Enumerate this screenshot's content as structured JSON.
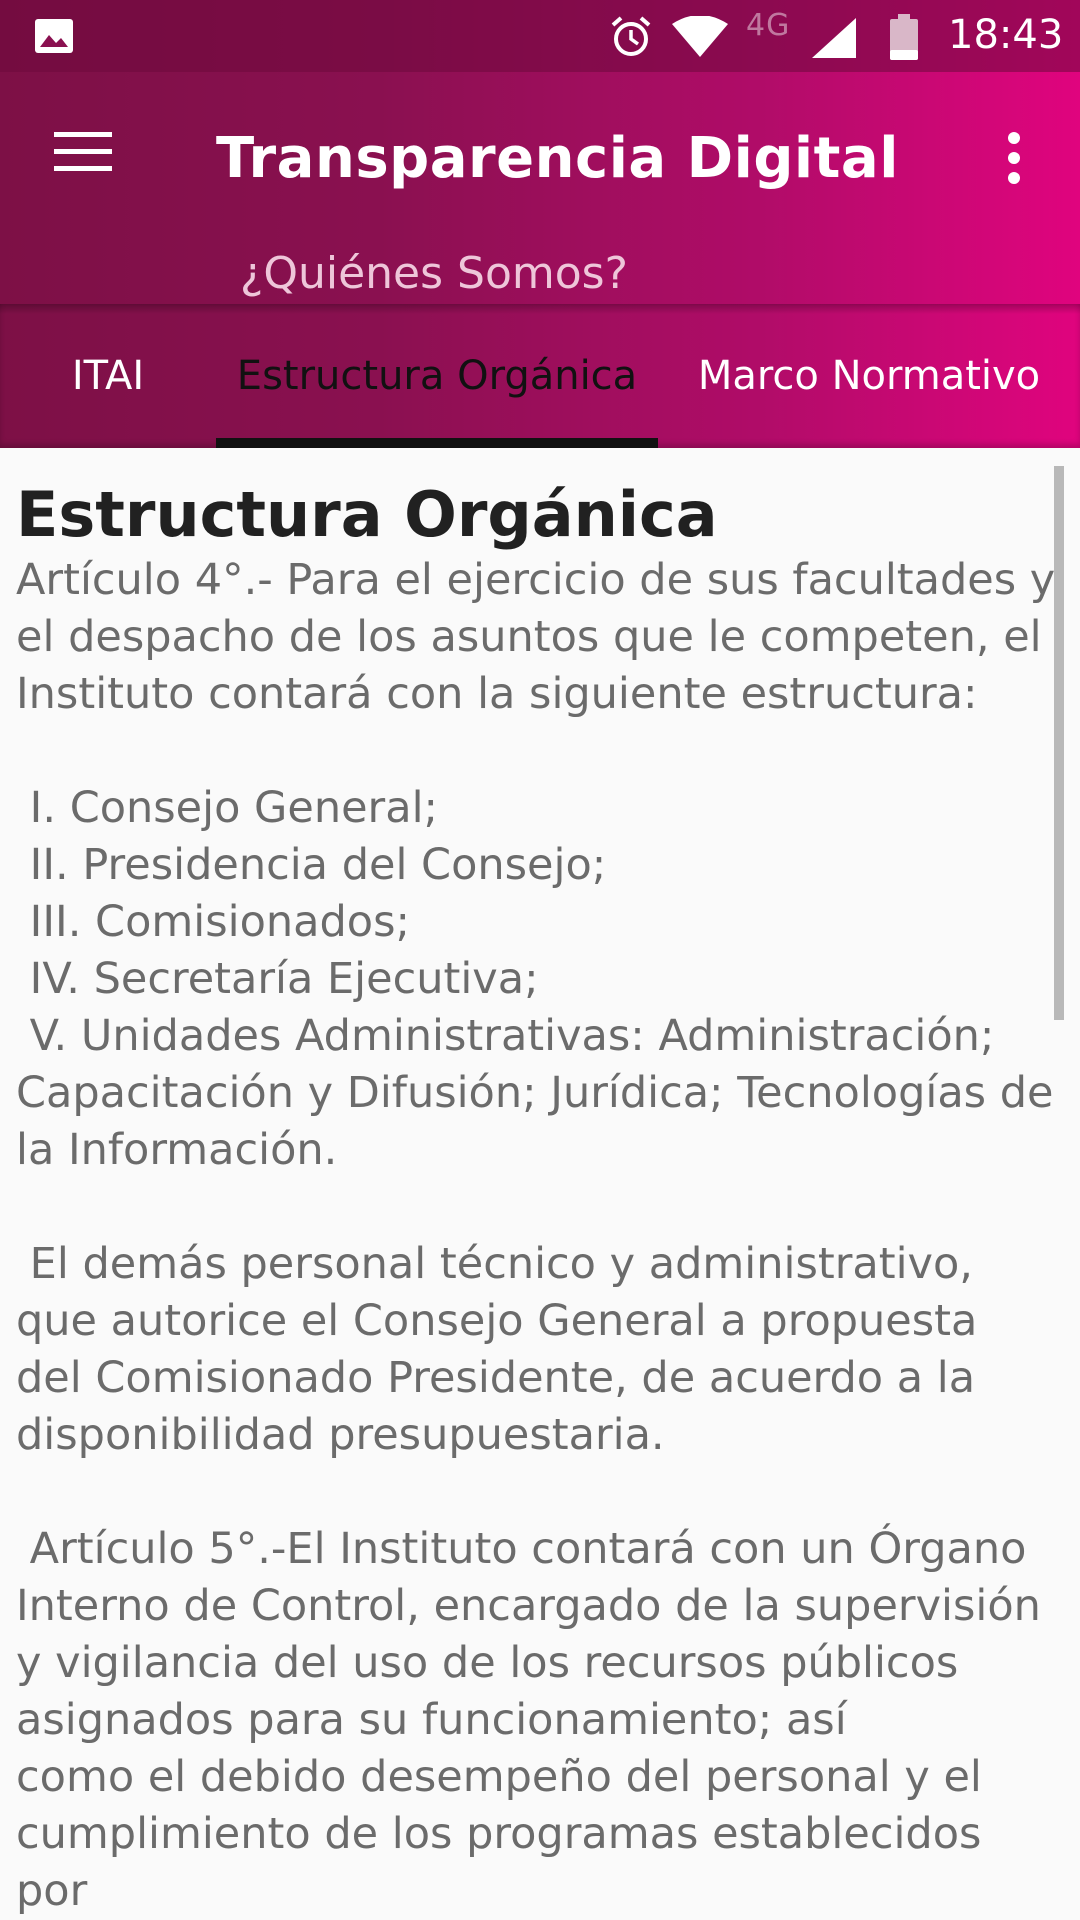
{
  "status_bar": {
    "network": "4G",
    "time": "18:43",
    "icons": [
      "gallery-icon",
      "alarm-icon",
      "wifi-icon",
      "signal-icon",
      "battery-icon"
    ]
  },
  "toolbar": {
    "title": "Transparencia Digital",
    "subtitle": "¿Quiénes Somos?",
    "icons": [
      "menu-icon",
      "overflow-menu-icon"
    ]
  },
  "tabs": [
    {
      "label": "ITAI",
      "active": false
    },
    {
      "label": "Estructura Orgánica",
      "active": true
    },
    {
      "label": "Marco Normativo",
      "active": false
    }
  ],
  "content": {
    "heading": "Estructura Orgánica",
    "body": "Artículo 4°.- Para el ejercicio de sus facultades y\nel despacho de los asuntos que le competen, el\nInstituto contará con la siguiente estructura:\n\n I. Consejo General;\n II. Presidencia del Consejo;\n III. Comisionados;\n IV. Secretaría Ejecutiva;\n V. Unidades Administrativas: Administración;\nCapacitación y Difusión; Jurídica; Tecnologías de\nla Información.\n\n El demás personal técnico y administrativo,\nque autorice el Consejo General a propuesta\ndel Comisionado Presidente, de acuerdo a la\ndisponibilidad presupuestaria.\n\n Artículo 5°.-El Instituto contará con un Órgano\nInterno de Control, encargado de la supervisión\ny vigilancia del uso de los recursos públicos\nasignados para su funcionamiento; así\ncomo el debido desempeño del personal y el\ncumplimiento de los programas establecidos por\nel Consejo General;"
  },
  "colors": {
    "header_start": "#7d1046",
    "header_end": "#e0047e",
    "tab_indicator": "#111111",
    "text_body": "#6b6b6b",
    "background": "#fafafa"
  }
}
